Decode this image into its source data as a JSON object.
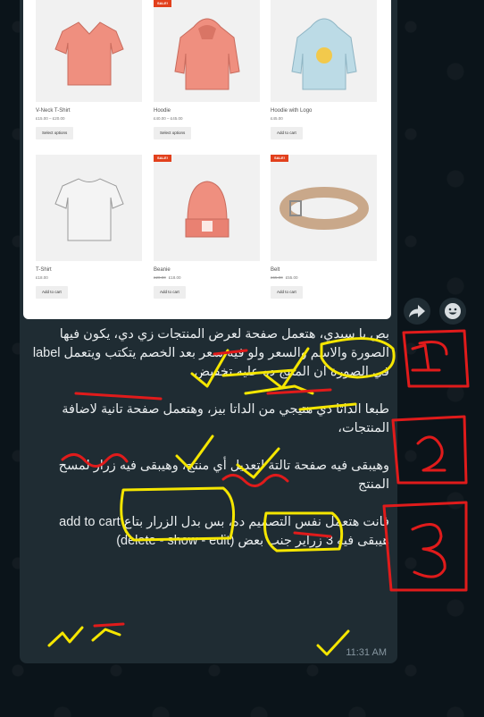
{
  "products": [
    {
      "name": "V-Neck T-Shirt",
      "price": "£15.00 – £20.00",
      "old_price": "",
      "button": "Select options",
      "sale": ""
    },
    {
      "name": "Hoodie",
      "price": "£40.00 – £45.00",
      "old_price": "",
      "button": "Select options",
      "sale": "SALE!"
    },
    {
      "name": "Hoodie with Logo",
      "price": "£45.00",
      "old_price": "",
      "button": "Add to cart",
      "sale": ""
    },
    {
      "name": "T-Shirt",
      "price": "£18.00",
      "old_price": "",
      "button": "Add to cart",
      "sale": ""
    },
    {
      "name": "Beanie",
      "price": "£18.00",
      "old_price": "£20.00",
      "button": "Add to cart",
      "sale": "SALE!"
    },
    {
      "name": "Belt",
      "price": "£55.00",
      "old_price": "£65.00",
      "button": "Add to cart",
      "sale": "SALE!"
    }
  ],
  "message": {
    "p1": "بص يا سيدي، هتعمل صفحة لعرض المنتجات زي دي، يكون فيها الصورة والاسم والسعر ولو فيه سعر بعد الخصم يتكتب ويتعمل label في الصورة ان المنتج ده عليه تخفيض",
    "p2": "طبعا الداتا دي هتيجي من الداتا بيز، وهتعمل صفحة تانية لاضافة المنتجات،",
    "p3": "وهيبقى فيه صفحة تالتة لتعديل أي منتج، وهيبقى فيه زرار لمسح المنتج",
    "p4": "فانت هتعمل نفس التصميم ده، بس بدل الزرار بتاع add to cart هيبقى فيه 3 زراير جنب بعض (delete - show - edit)",
    "time": "11:31 AM"
  },
  "icons": {
    "forward": "forward-arrow-icon",
    "emoji": "smiley-icon"
  },
  "colors": {
    "background": "#0b141a",
    "bubble": "#1f2c33",
    "text": "#e9edef",
    "sale_badge": "#e2401c",
    "annotation_yellow": "#f5e600",
    "annotation_red": "#e01b1b"
  }
}
